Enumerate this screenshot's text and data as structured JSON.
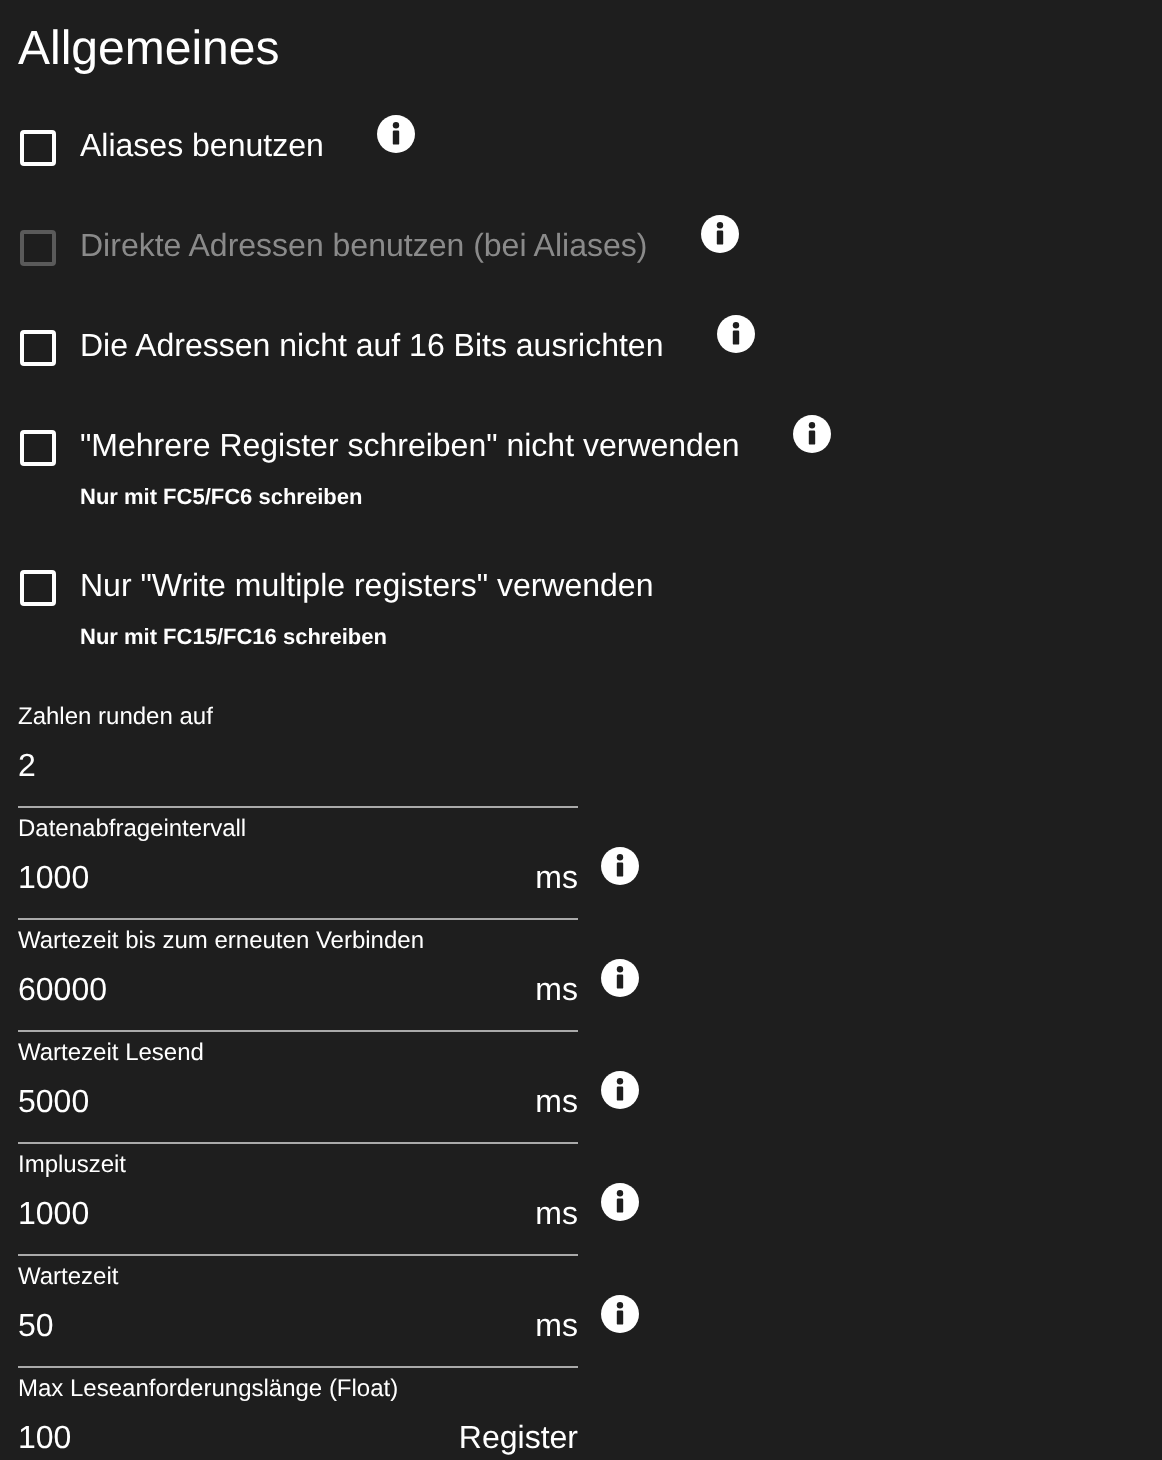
{
  "title": "Allgemeines",
  "checkboxes": [
    {
      "label": "Aliases benutzen",
      "checked": false,
      "disabled": false,
      "info": true
    },
    {
      "label": "Direkte Adressen benutzen (bei Aliases)",
      "checked": false,
      "disabled": true,
      "info": true
    },
    {
      "label": "Die Adressen nicht auf 16 Bits ausrichten",
      "checked": false,
      "disabled": false,
      "info": true
    },
    {
      "label": "\"Mehrere Register schreiben\" nicht verwenden",
      "checked": false,
      "disabled": false,
      "info": true,
      "helper": "Nur mit FC5/FC6 schreiben"
    },
    {
      "label": "Nur \"Write multiple registers\" verwenden",
      "checked": false,
      "disabled": false,
      "info": false,
      "helper": "Nur mit FC15/FC16 schreiben"
    }
  ],
  "fields": [
    {
      "label": "Zahlen runden auf",
      "value": "2",
      "info": false
    },
    {
      "label": "Datenabfrageintervall",
      "value": "1000",
      "unit": "ms",
      "info": true
    },
    {
      "label": "Wartezeit bis zum erneuten Verbinden",
      "value": "60000",
      "unit": "ms",
      "info": true
    },
    {
      "label": "Wartezeit Lesend",
      "value": "5000",
      "unit": "ms",
      "info": true
    },
    {
      "label": "Impluszeit",
      "value": "1000",
      "unit": "ms",
      "info": true
    },
    {
      "label": "Wartezeit",
      "value": "50",
      "unit": "ms",
      "info": true
    },
    {
      "label": "Max Leseanforderungslänge (Float)",
      "value": "100",
      "unit": "Register",
      "info": false
    }
  ]
}
